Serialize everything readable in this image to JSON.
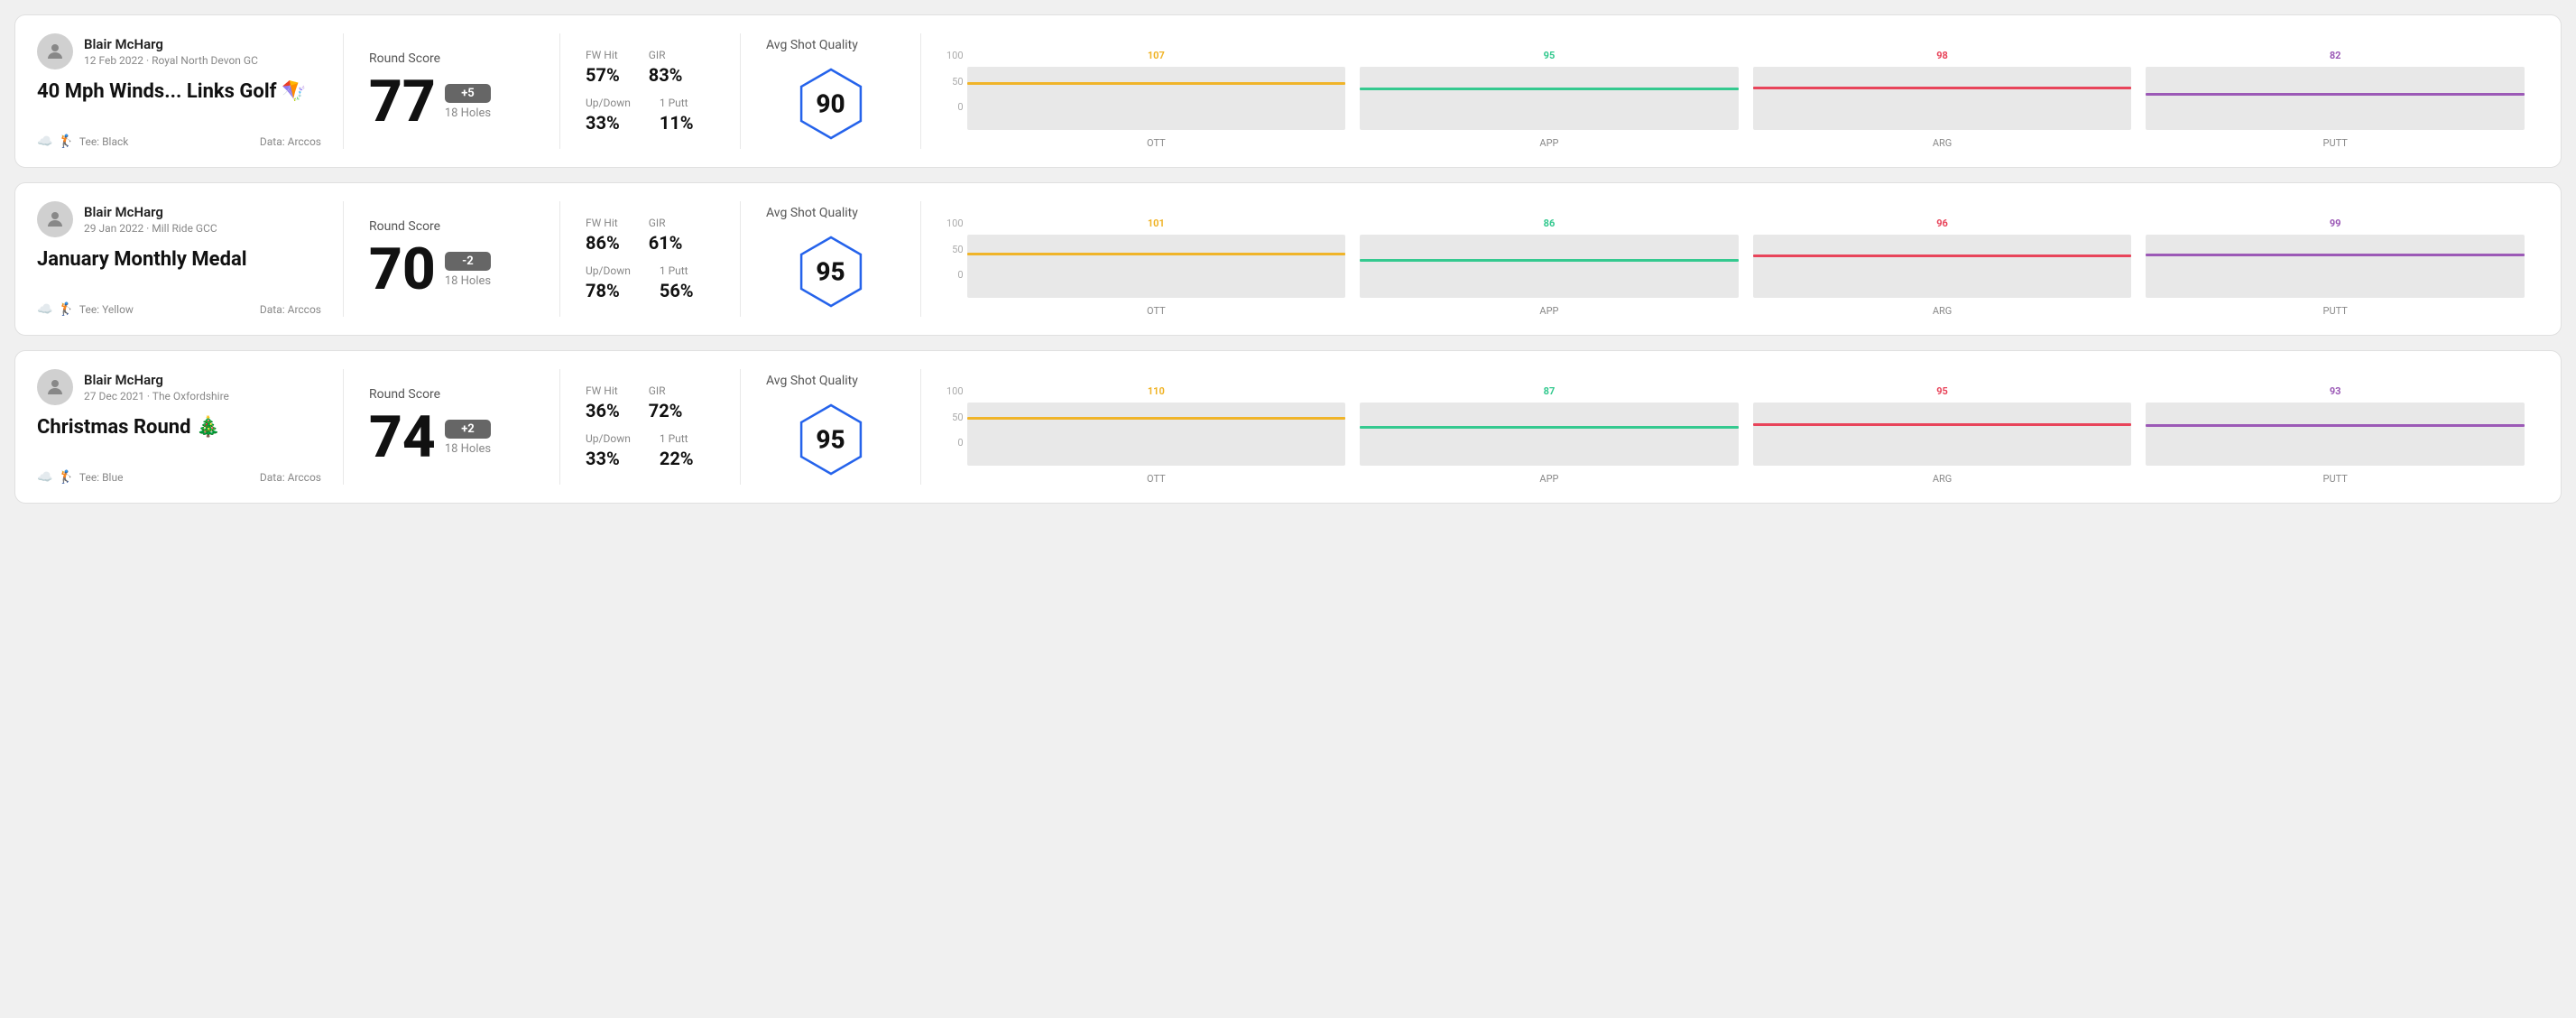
{
  "rounds": [
    {
      "user_name": "Blair McHarg",
      "user_meta": "12 Feb 2022 · Royal North Devon GC",
      "round_title": "40 Mph Winds... Links Golf 🪁",
      "tee": "Tee: Black",
      "data_source": "Data: Arccos",
      "round_score_label": "Round Score",
      "score": "77",
      "score_badge": "+5",
      "score_badge_type": "positive",
      "holes": "18 Holes",
      "fw_hit_label": "FW Hit",
      "fw_hit_value": "57%",
      "gir_label": "GIR",
      "gir_value": "83%",
      "updown_label": "Up/Down",
      "updown_value": "33%",
      "oneputt_label": "1 Putt",
      "oneputt_value": "11%",
      "avg_shot_quality_label": "Avg Shot Quality",
      "quality_score": "90",
      "chart": {
        "columns": [
          {
            "label": "OTT",
            "value": 107,
            "color_class": "color-ott",
            "fill_class": "fill-ott",
            "bar_pct": 71
          },
          {
            "label": "APP",
            "value": 95,
            "color_class": "color-app",
            "fill_class": "fill-app",
            "bar_pct": 63
          },
          {
            "label": "ARG",
            "value": 98,
            "color_class": "color-arg",
            "fill_class": "fill-arg",
            "bar_pct": 65
          },
          {
            "label": "PUTT",
            "value": 82,
            "color_class": "color-putt",
            "fill_class": "fill-putt",
            "bar_pct": 55
          }
        ]
      }
    },
    {
      "user_name": "Blair McHarg",
      "user_meta": "29 Jan 2022 · Mill Ride GCC",
      "round_title": "January Monthly Medal",
      "tee": "Tee: Yellow",
      "data_source": "Data: Arccos",
      "round_score_label": "Round Score",
      "score": "70",
      "score_badge": "-2",
      "score_badge_type": "negative",
      "holes": "18 Holes",
      "fw_hit_label": "FW Hit",
      "fw_hit_value": "86%",
      "gir_label": "GIR",
      "gir_value": "61%",
      "updown_label": "Up/Down",
      "updown_value": "78%",
      "oneputt_label": "1 Putt",
      "oneputt_value": "56%",
      "avg_shot_quality_label": "Avg Shot Quality",
      "quality_score": "95",
      "chart": {
        "columns": [
          {
            "label": "OTT",
            "value": 101,
            "color_class": "color-ott",
            "fill_class": "fill-ott",
            "bar_pct": 67
          },
          {
            "label": "APP",
            "value": 86,
            "color_class": "color-app",
            "fill_class": "fill-app",
            "bar_pct": 57
          },
          {
            "label": "ARG",
            "value": 96,
            "color_class": "color-arg",
            "fill_class": "fill-arg",
            "bar_pct": 64
          },
          {
            "label": "PUTT",
            "value": 99,
            "color_class": "color-putt",
            "fill_class": "fill-putt",
            "bar_pct": 66
          }
        ]
      }
    },
    {
      "user_name": "Blair McHarg",
      "user_meta": "27 Dec 2021 · The Oxfordshire",
      "round_title": "Christmas Round 🎄",
      "tee": "Tee: Blue",
      "data_source": "Data: Arccos",
      "round_score_label": "Round Score",
      "score": "74",
      "score_badge": "+2",
      "score_badge_type": "positive",
      "holes": "18 Holes",
      "fw_hit_label": "FW Hit",
      "fw_hit_value": "36%",
      "gir_label": "GIR",
      "gir_value": "72%",
      "updown_label": "Up/Down",
      "updown_value": "33%",
      "oneputt_label": "1 Putt",
      "oneputt_value": "22%",
      "avg_shot_quality_label": "Avg Shot Quality",
      "quality_score": "95",
      "chart": {
        "columns": [
          {
            "label": "OTT",
            "value": 110,
            "color_class": "color-ott",
            "fill_class": "fill-ott",
            "bar_pct": 73
          },
          {
            "label": "APP",
            "value": 87,
            "color_class": "color-app",
            "fill_class": "fill-app",
            "bar_pct": 58
          },
          {
            "label": "ARG",
            "value": 95,
            "color_class": "color-arg",
            "fill_class": "fill-arg",
            "bar_pct": 63
          },
          {
            "label": "PUTT",
            "value": 93,
            "color_class": "color-putt",
            "fill_class": "fill-putt",
            "bar_pct": 62
          }
        ]
      }
    }
  ],
  "chart_y_labels": {
    "top": "100",
    "mid": "50",
    "bottom": "0"
  }
}
